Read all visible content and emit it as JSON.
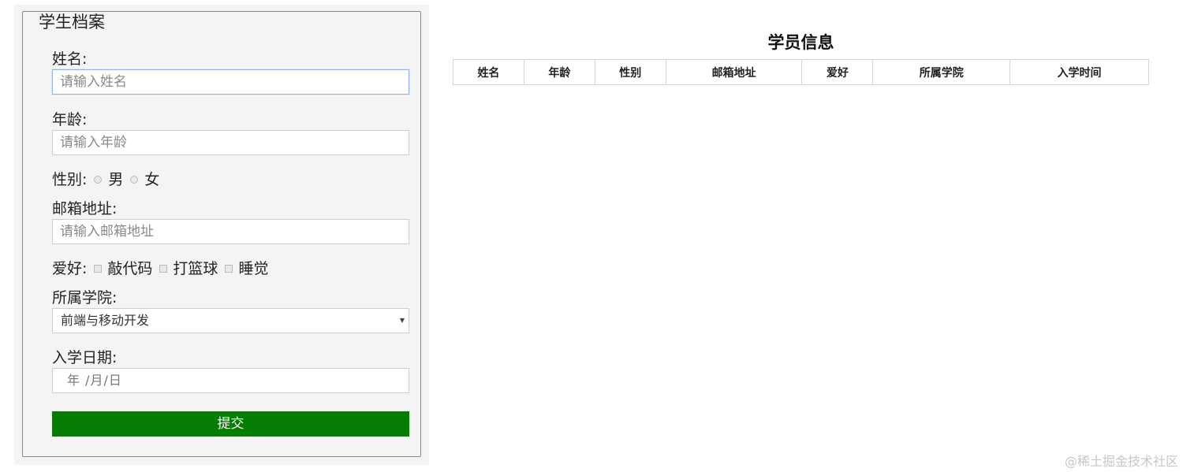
{
  "form": {
    "legend": "学生档案",
    "name_label": "姓名:",
    "name_placeholder": "请输入姓名",
    "age_label": "年龄:",
    "age_placeholder": "请输入年龄",
    "gender_label": "性别:",
    "gender_options": [
      "男",
      "女"
    ],
    "email_label": "邮箱地址:",
    "email_placeholder": "请输入邮箱地址",
    "hobby_label": "爱好:",
    "hobby_options": [
      "敲代码",
      "打篮球",
      "睡觉"
    ],
    "college_label": "所属学院:",
    "college_selected": "前端与移动开发",
    "date_label": "入学日期:",
    "date_placeholder": "年 /月/日",
    "submit_label": "提交",
    "submit_color": "#057d05"
  },
  "table": {
    "title": "学员信息",
    "headers": [
      "姓名",
      "年龄",
      "性别",
      "邮箱地址",
      "爱好",
      "所属学院",
      "入学时间"
    ]
  },
  "watermark": "@稀土掘金技术社区"
}
